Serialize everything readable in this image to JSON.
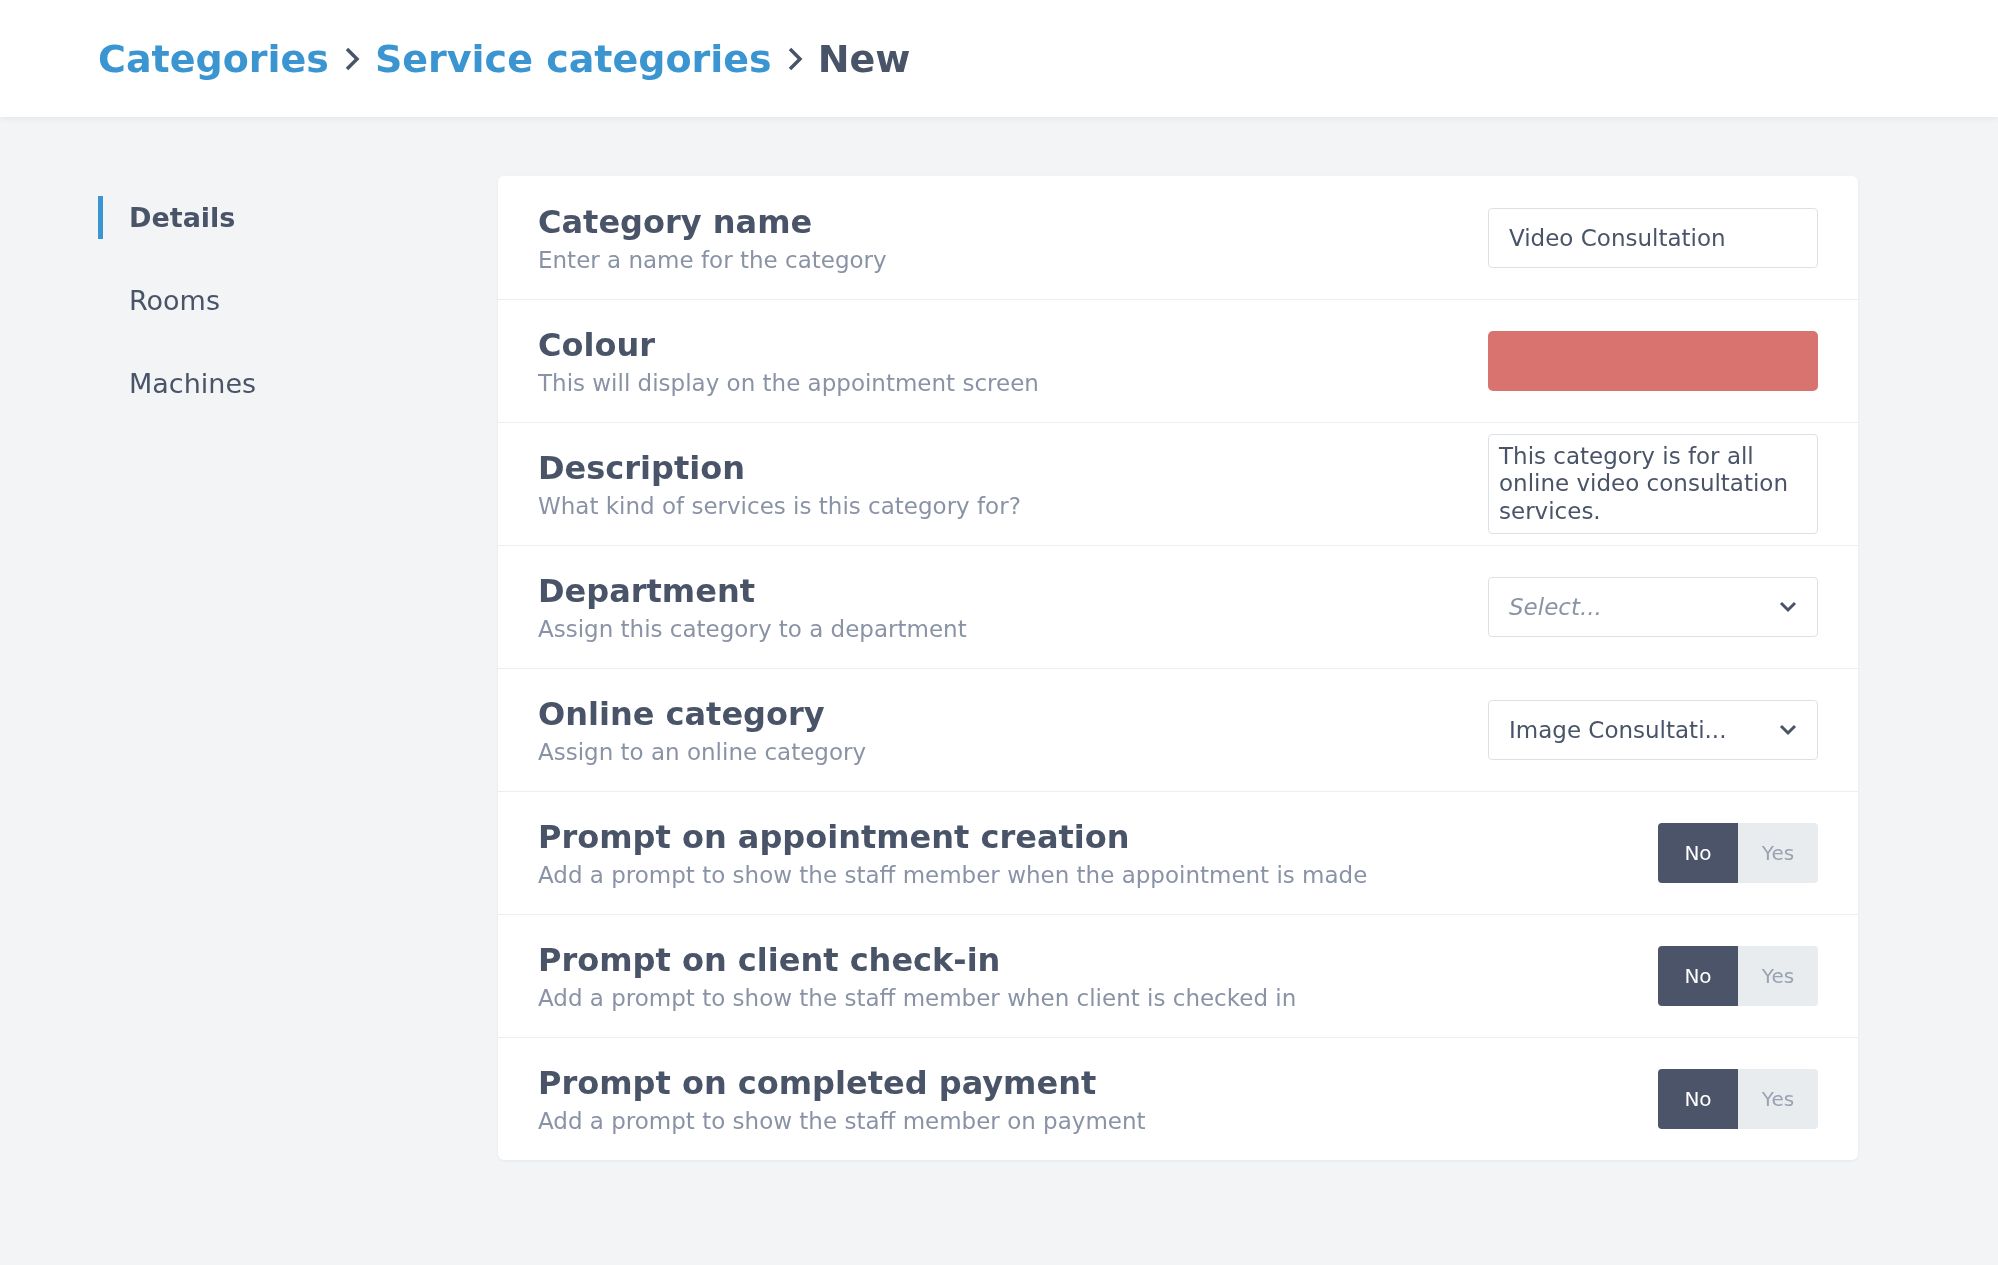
{
  "breadcrumb": [
    {
      "label": "Categories",
      "kind": "link"
    },
    {
      "label": "Service categories",
      "kind": "link"
    },
    {
      "label": "New",
      "kind": "current"
    }
  ],
  "sidebar": {
    "items": [
      {
        "label": "Details",
        "selected": true
      },
      {
        "label": "Rooms",
        "selected": false
      },
      {
        "label": "Machines",
        "selected": false
      }
    ]
  },
  "form": {
    "rows": [
      {
        "kind": "text",
        "title": "Category name",
        "subtitle": "Enter a name for the category",
        "value": "Video Consultation"
      },
      {
        "kind": "color",
        "title": "Colour",
        "subtitle": "This will display on the appointment screen",
        "color": "#d8736f"
      },
      {
        "kind": "textarea",
        "title": "Description",
        "subtitle": "What kind of services is this category for?",
        "value": "This category is for all online video consultation services."
      },
      {
        "kind": "select",
        "title": "Department",
        "subtitle": "Assign this category to a department",
        "placeholder": "Select..."
      },
      {
        "kind": "select",
        "title": "Online category",
        "subtitle": "Assign to an online category",
        "value": "Image Consultati..."
      },
      {
        "kind": "toggle",
        "title": "Prompt on appointment creation",
        "subtitle": "Add a prompt to show the staff member when the appointment is made",
        "options": [
          {
            "label": "No",
            "selected": true
          },
          {
            "label": "Yes",
            "selected": false
          }
        ]
      },
      {
        "kind": "toggle",
        "title": "Prompt on client check-in",
        "subtitle": "Add a prompt to show the staff member when client is checked in",
        "options": [
          {
            "label": "No",
            "selected": true
          },
          {
            "label": "Yes",
            "selected": false
          }
        ]
      },
      {
        "kind": "toggle",
        "title": "Prompt on completed payment",
        "subtitle": "Add a prompt to show the staff member on payment",
        "options": [
          {
            "label": "No",
            "selected": true
          },
          {
            "label": "Yes",
            "selected": false
          }
        ]
      }
    ]
  }
}
